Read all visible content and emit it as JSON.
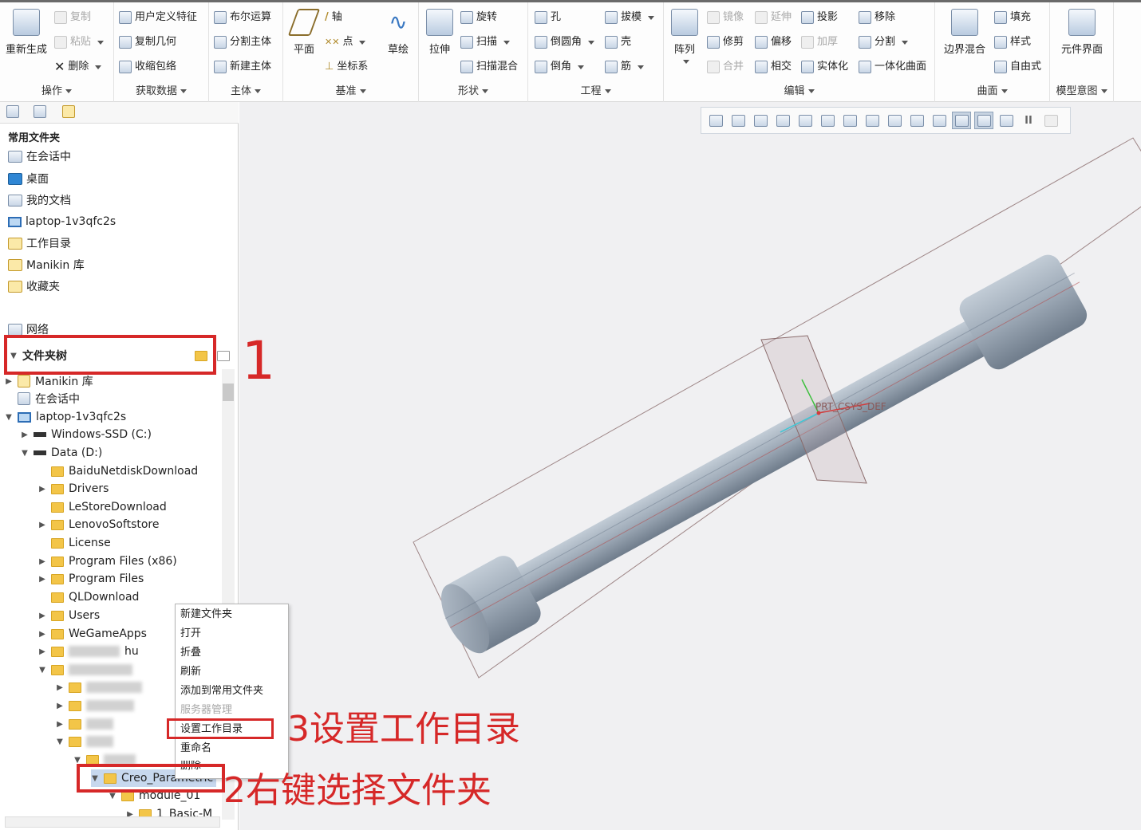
{
  "ribbon": {
    "operation": {
      "regen": "重新生成",
      "copy": "复制",
      "paste": "粘贴",
      "delete": "删除",
      "label": "操作"
    },
    "getdata": {
      "udf": "用户定义特征",
      "copygeom": "复制几何",
      "shrinkwrap": "收缩包络",
      "label": "获取数据"
    },
    "body": {
      "boolean": "布尔运算",
      "split": "分割主体",
      "new": "新建主体",
      "label": "主体"
    },
    "datum": {
      "plane": "平面",
      "axis": "轴",
      "point": "点",
      "csys": "坐标系",
      "sketch": "草绘",
      "label": "基准"
    },
    "shapes": {
      "extrude": "拉伸",
      "revolve": "旋转",
      "sweep": "扫描",
      "sweepblend": "扫描混合",
      "label": "形状"
    },
    "engineering": {
      "hole": "孔",
      "round": "倒圆角",
      "chamfer": "倒角",
      "draft": "拔模",
      "shell": "壳",
      "rib": "筋",
      "label": "工程"
    },
    "editing": {
      "pattern": "阵列",
      "mirror": "镜像",
      "extend": "延伸",
      "project": "投影",
      "trim": "修剪",
      "offset": "偏移",
      "thicken": "加厚",
      "merge": "合并",
      "intersect": "相交",
      "solidify": "实体化",
      "remove": "移除",
      "split": "分割",
      "unify": "一体化曲面",
      "label": "编辑"
    },
    "surfaces": {
      "boundary": "边界混合",
      "fill": "填充",
      "style": "样式",
      "freestyle": "自由式",
      "label": "曲面"
    },
    "modelintent": {
      "interface": "元件界面",
      "label": "模型意图"
    }
  },
  "left": {
    "common_header": "常用文件夹",
    "favorites": [
      "在会话中",
      "桌面",
      "我的文档",
      "laptop-1v3qfc2s",
      "工作目录",
      "Manikin 库",
      "收藏夹"
    ],
    "network": "网络",
    "tree_header": "文件夹树",
    "tree": {
      "manikin": "Manikin 库",
      "session": "在会话中",
      "laptop": "laptop-1v3qfc2s",
      "c_drive": "Windows-SSD (C:)",
      "d_drive": "Data (D:)",
      "folders": [
        "BaiduNetdiskDownload",
        "Drivers",
        "LeStoreDownload",
        "LenovoSoftstore",
        "License",
        "Program Files (x86)",
        "Program Files",
        "QLDownload",
        "Users",
        "WeGameApps"
      ],
      "partial": "hu",
      "creo": "Creo_Parametric",
      "module": "module_01",
      "basic": "1_Basic-M"
    }
  },
  "viewport": {
    "csys_label": "PRT_CSYS_DEF"
  },
  "context_menu": [
    "新建文件夹",
    "打开",
    "折叠",
    "刷新",
    "添加到常用文件夹",
    "服务器管理",
    "设置工作目录",
    "重命名",
    "删除"
  ],
  "annotations": {
    "a1": "1",
    "a2": "2右键选择文件夹",
    "a3": "3设置工作目录"
  },
  "colors": {
    "annotation": "#d62828",
    "model": "#9aa6b2",
    "selected": "#c7d8ee"
  }
}
